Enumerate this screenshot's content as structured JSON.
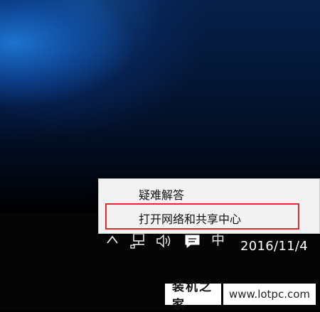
{
  "context_menu": {
    "items": [
      {
        "label": "疑难解答"
      },
      {
        "label": "打开网络和共享中心"
      }
    ]
  },
  "tray": {
    "icons": [
      "chevron-up-icon",
      "network-icon",
      "volume-icon",
      "action-center-icon",
      "ime-icon"
    ],
    "ime_label": "中"
  },
  "clock": {
    "date": "2016/11/4"
  },
  "watermark": {
    "brand": "装机之家",
    "url": "www.lotpc.com"
  },
  "colors": {
    "highlight": "#e32b2b",
    "menu_bg": "#f2f2f2",
    "taskbar": "#050505"
  }
}
